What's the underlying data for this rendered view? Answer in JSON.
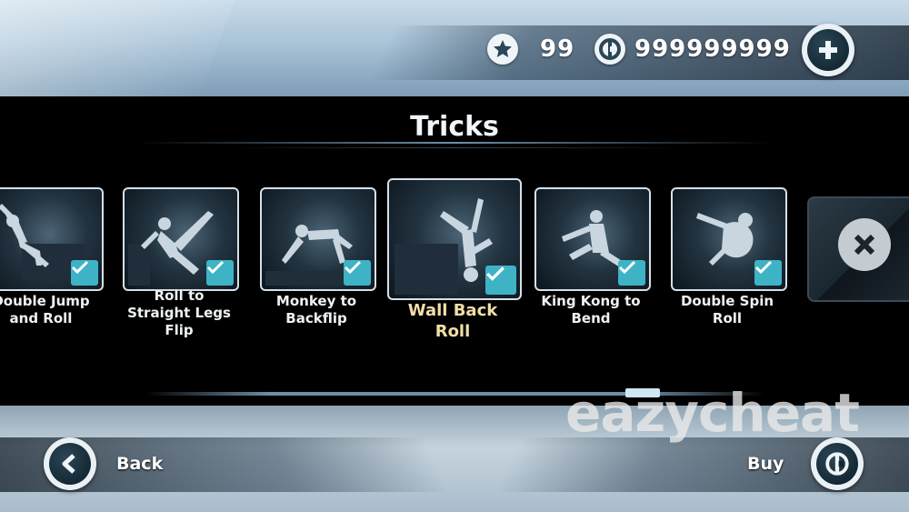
{
  "header": {
    "stars": "99",
    "coins": "999999999",
    "add_label": "+"
  },
  "screen": {
    "title": "Tricks"
  },
  "tricks": [
    {
      "name": "Double Jump and Roll",
      "line1": "Double Jump",
      "line2": "and Roll",
      "line3": "",
      "owned": true,
      "selected": false
    },
    {
      "name": "Roll to Straight Legs Flip",
      "line1": "Roll to",
      "line2": "Straight Legs",
      "line3": "Flip",
      "owned": true,
      "selected": false
    },
    {
      "name": "Monkey to Backflip",
      "line1": "Monkey to",
      "line2": "Backflip",
      "line3": "",
      "owned": true,
      "selected": false
    },
    {
      "name": "Wall Back Roll",
      "line1": "Wall Back",
      "line2": "Roll",
      "line3": "",
      "owned": true,
      "selected": true
    },
    {
      "name": "King Kong to Bend",
      "line1": "King Kong to",
      "line2": "Bend",
      "line3": "",
      "owned": true,
      "selected": false
    },
    {
      "name": "Double Spin Roll",
      "line1": "Double Spin",
      "line2": "Roll",
      "line3": "",
      "owned": true,
      "selected": false
    }
  ],
  "footer": {
    "back_label": "Back",
    "buy_label": "Buy"
  },
  "watermark": "eazycheat",
  "colors": {
    "accent": "#3fb3c6",
    "selected_text": "#f2dfa8",
    "background": "#000000"
  },
  "icons": [
    "star-icon",
    "coin-icon",
    "plus-icon",
    "check-icon",
    "lock-x-icon",
    "back-arrow-icon"
  ]
}
